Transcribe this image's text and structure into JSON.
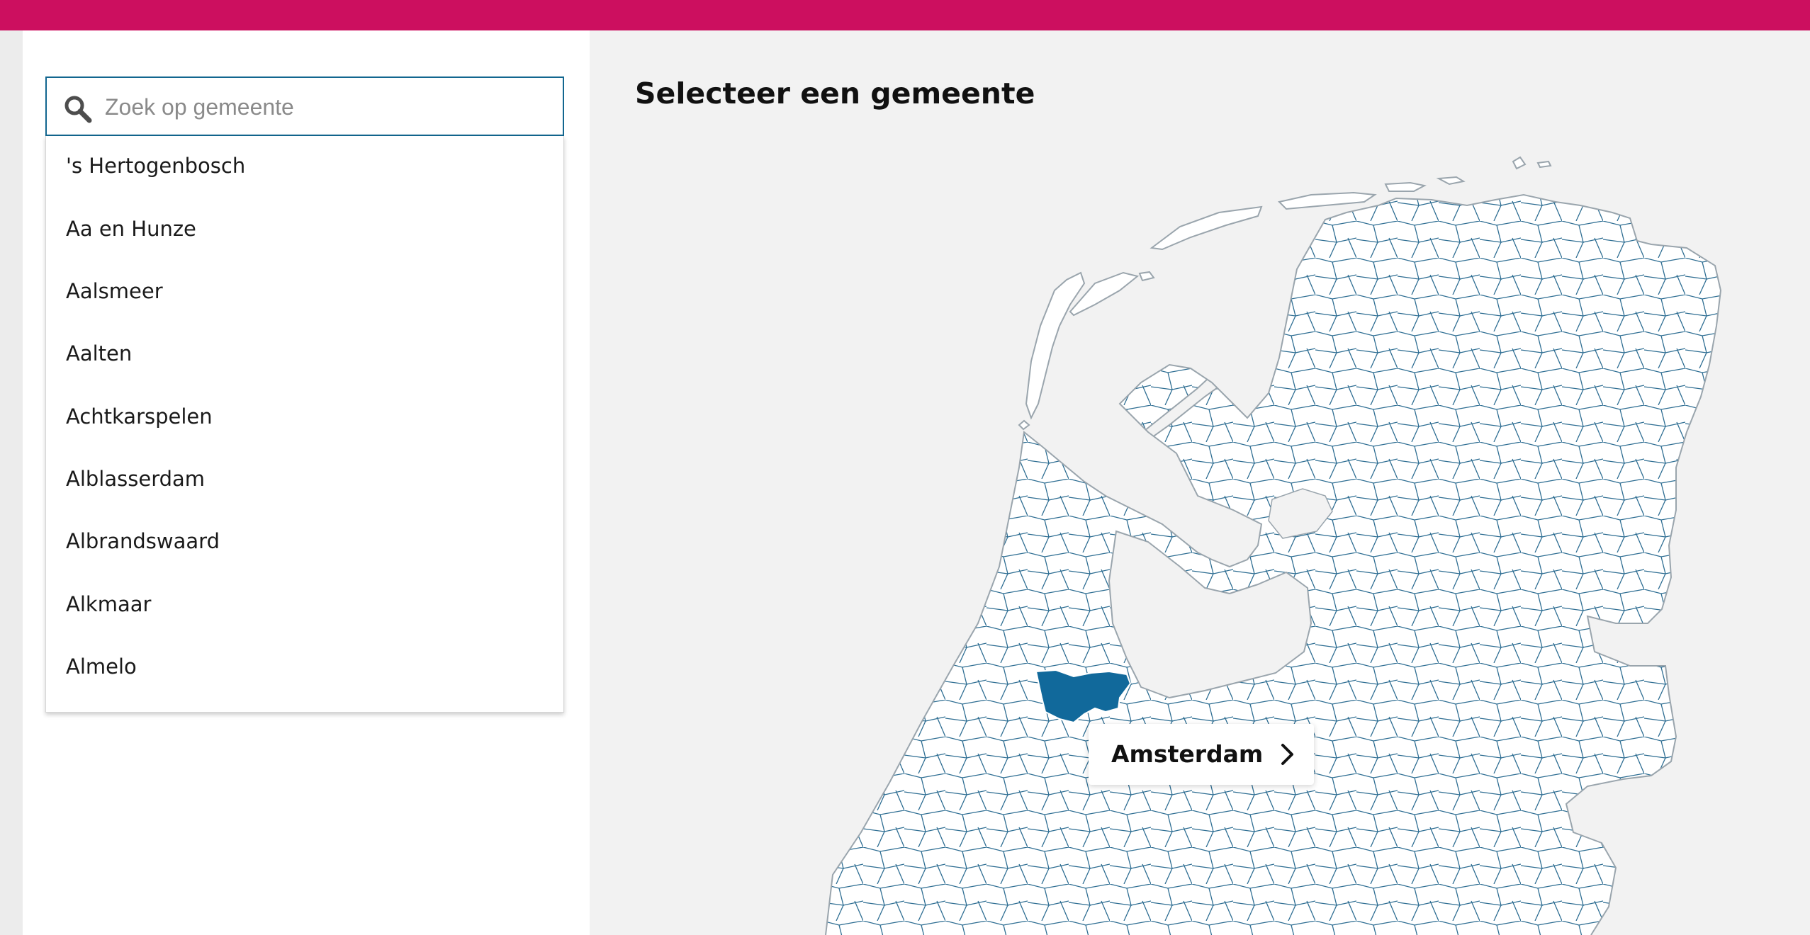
{
  "colors": {
    "topbar": "#cc0f5f",
    "search_border": "#12668f",
    "map_border": "#2d6d92",
    "highlight": "#11699b",
    "page_background": "#f2f2f2"
  },
  "search": {
    "placeholder": "Zoek op gemeente",
    "value": "",
    "icon": "search-icon"
  },
  "municipality_list": [
    "'s Hertogenbosch",
    "Aa en Hunze",
    "Aalsmeer",
    "Aalten",
    "Achtkarspelen",
    "Alblasserdam",
    "Albrandswaard",
    "Alkmaar",
    "Almelo"
  ],
  "main": {
    "title": "Selecteer een gemeente"
  },
  "map": {
    "selected_municipality": "Amsterdam",
    "tooltip_label": "Amsterdam",
    "tooltip_icon": "chevron-right-icon"
  }
}
